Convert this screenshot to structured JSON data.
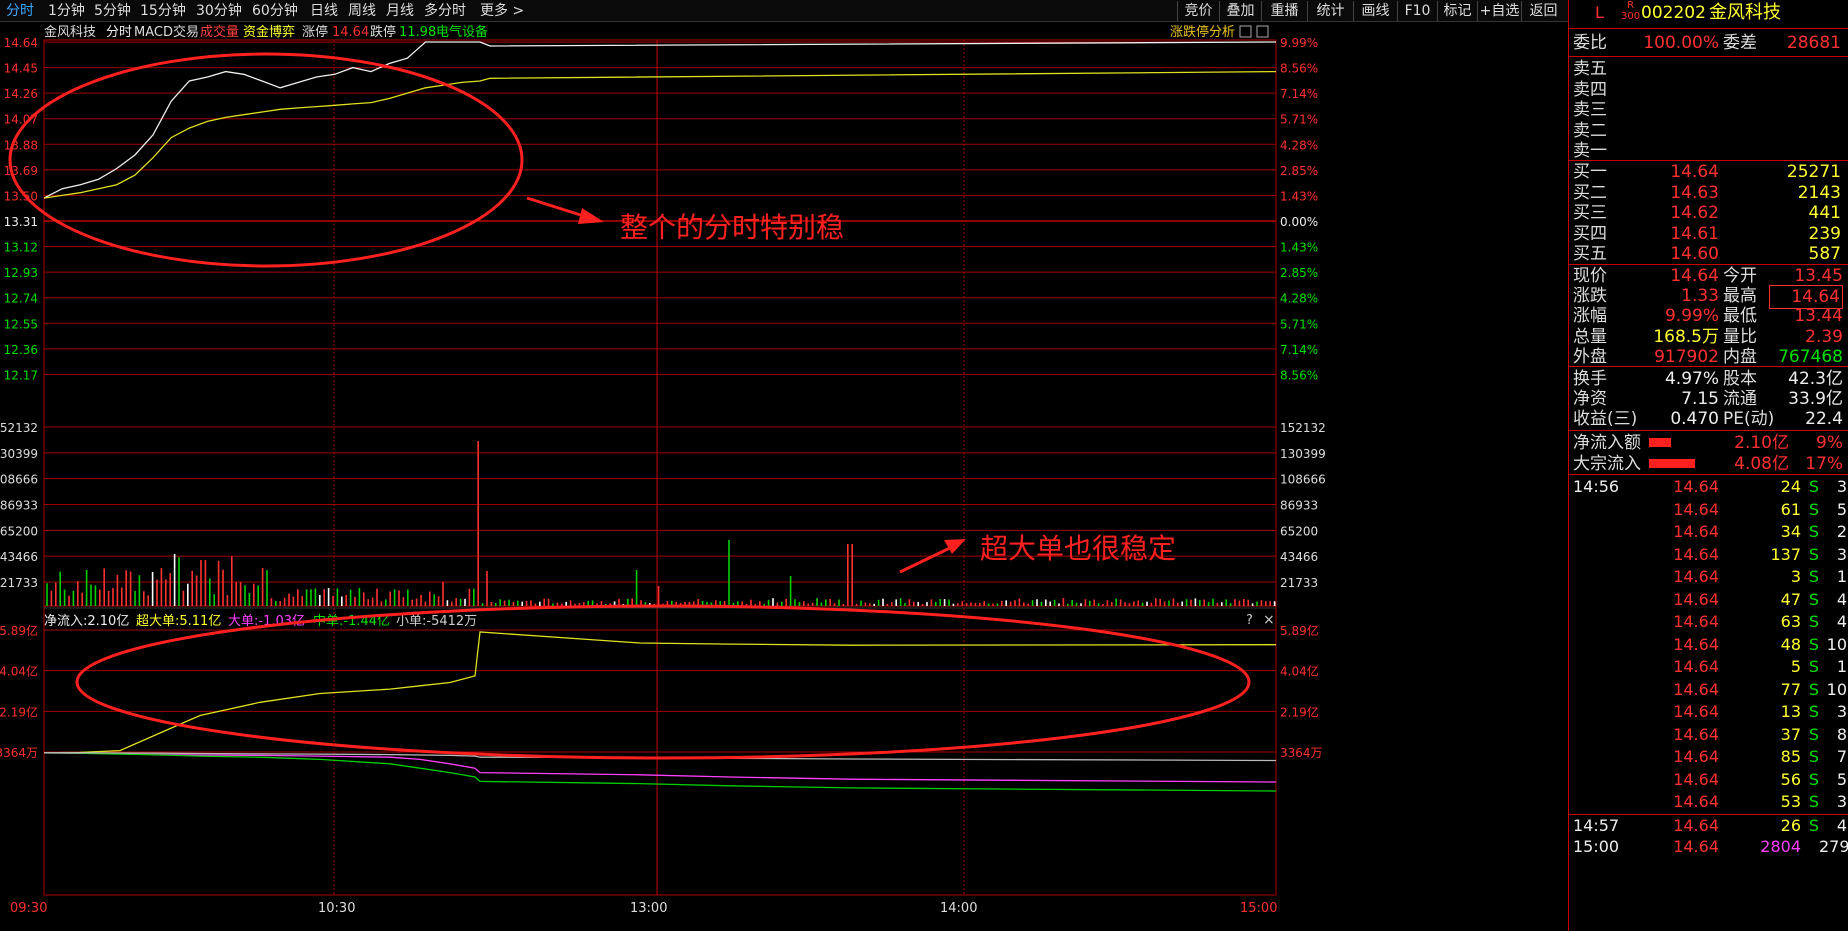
{
  "toolbar": {
    "tabs": [
      "分时",
      "1分钟",
      "5分钟",
      "15分钟",
      "30分钟",
      "60分钟",
      "日线",
      "周线",
      "月线",
      "多分时",
      "更多 >"
    ],
    "right_buttons": [
      "竞价",
      "叠加",
      "重播",
      "统计",
      "画线",
      "F10",
      "标记",
      "+自选",
      "返回"
    ]
  },
  "chart_header": {
    "stock_name": "金风科技",
    "mode": "分时",
    "indicators": [
      "MACD交易",
      "成交量",
      "资金博弈"
    ],
    "limit_up_label": "涨停",
    "limit_up_value": "14.64",
    "limit_down_label": "跌停",
    "limit_down_value": "11.98",
    "sector": "电气设备",
    "analysis_btn": "涨跌停分析"
  },
  "price_axis": {
    "left": [
      "14.64",
      "14.45",
      "14.26",
      "14.07",
      "13.88",
      "13.69",
      "13.50",
      "13.31",
      "13.12",
      "12.93",
      "12.74",
      "12.55",
      "12.36",
      "12.17"
    ],
    "right": [
      "9.99%",
      "8.56%",
      "7.14%",
      "5.71%",
      "4.28%",
      "2.85%",
      "1.43%",
      "0.00%",
      "1.43%",
      "2.85%",
      "4.28%",
      "5.71%",
      "7.14%",
      "8.56%"
    ]
  },
  "volume_axis": {
    "left": [
      "52132",
      "30399",
      "08666",
      "86933",
      "65200",
      "43466",
      "21733"
    ],
    "right": [
      "152132",
      "130399",
      "108666",
      "86933",
      "65200",
      "43466",
      "21733"
    ]
  },
  "flow_header": {
    "net": "净流入:2.10亿",
    "super_large": "超大单:5.11亿",
    "large": "大单:-1.03亿",
    "medium": "中单:-1.44亿",
    "small": "小单:-5412万",
    "help": "?",
    "close": "×"
  },
  "flow_axis": {
    "left": [
      "5.89亿",
      "4.04亿",
      "2.19亿",
      "3364万"
    ],
    "right": [
      "5.89亿",
      "4.04亿",
      "2.19亿",
      "3364万"
    ]
  },
  "time_axis": [
    "09:30",
    "10:30",
    "13:00",
    "14:00",
    "15:00"
  ],
  "annotations": {
    "price_note": "整个的分时特别稳",
    "volume_note": "超大单也很稳定"
  },
  "chart_data": {
    "type": "line",
    "price": {
      "x": [
        "09:30",
        "09:35",
        "09:40",
        "09:45",
        "09:50",
        "09:55",
        "10:00",
        "10:05",
        "10:10",
        "10:15",
        "10:20",
        "10:25",
        "10:30",
        "10:35",
        "10:40",
        "10:45",
        "10:50",
        "10:55",
        "11:00",
        "11:05",
        "11:10",
        "11:15",
        "11:20",
        "11:25",
        "11:30",
        "13:00",
        "15:00"
      ],
      "series": [
        {
          "values": [
            13.48,
            13.55,
            13.58,
            13.62,
            13.7,
            13.8,
            13.95,
            14.2,
            14.35,
            14.38,
            14.42,
            14.4,
            14.35,
            14.3,
            14.34,
            14.38,
            14.4,
            14.45,
            14.42,
            14.48,
            14.52,
            14.64,
            14.64,
            14.64,
            14.64,
            14.61,
            14.64
          ]
        },
        {
          "values": [
            13.48,
            13.5,
            13.52,
            13.55,
            13.58,
            13.65,
            13.78,
            13.93,
            14.0,
            14.05,
            14.08,
            14.1,
            14.12,
            14.14,
            14.15,
            14.16,
            14.17,
            14.18,
            14.19,
            14.22,
            14.26,
            14.3,
            14.32,
            14.34,
            14.35,
            14.37,
            14.42
          ]
        }
      ],
      "ylim": [
        12.17,
        14.64
      ]
    },
    "fund_flow": {
      "series": [
        {
          "name": "超大单",
          "values": [
            0.3,
            0.32,
            0.4,
            1.2,
            2.0,
            2.6,
            3.0,
            3.2,
            3.35,
            3.5,
            3.8,
            5.8,
            5.3,
            5.25,
            5.2,
            5.22
          ]
        },
        {
          "name": "大单",
          "values": [
            0.3,
            0.28,
            0.25,
            0.22,
            0.2,
            0.18,
            0.15,
            0.1,
            0.0,
            -0.2,
            -0.4,
            -0.6,
            -0.7,
            -0.8,
            -0.9,
            -1.03
          ]
        },
        {
          "name": "中单",
          "values": [
            0.3,
            0.28,
            0.24,
            0.2,
            0.15,
            0.1,
            0.0,
            -0.2,
            -0.4,
            -0.6,
            -0.8,
            -1.0,
            -1.1,
            -1.2,
            -1.3,
            -1.44
          ]
        },
        {
          "name": "小单",
          "values": [
            0.3,
            0.3,
            0.29,
            0.28,
            0.27,
            0.25,
            0.24,
            0.22,
            0.2,
            0.18,
            0.15,
            0.1,
            0.08,
            0.05,
            0.02,
            -0.05
          ]
        }
      ],
      "ylim": [
        -1.6,
        6.2
      ]
    }
  },
  "quote_panel": {
    "market_tag": "L",
    "index_tag": "R\n300",
    "code": "002202",
    "name": "金风科技",
    "weibi_label": "委比",
    "weibi_value": "100.00%",
    "weicha_label": "委差",
    "weicha_value": "28681",
    "asks": [
      "卖五",
      "卖四",
      "卖三",
      "卖二",
      "卖一"
    ],
    "bids": [
      {
        "label": "买一",
        "price": "14.64",
        "vol": "25271"
      },
      {
        "label": "买二",
        "price": "14.63",
        "vol": "2143"
      },
      {
        "label": "买三",
        "price": "14.62",
        "vol": "441"
      },
      {
        "label": "买四",
        "price": "14.61",
        "vol": "239"
      },
      {
        "label": "买五",
        "price": "14.60",
        "vol": "587"
      }
    ],
    "stats": [
      {
        "l1": "现价",
        "v1": "14.64",
        "c1": "red",
        "l2": "今开",
        "v2": "13.45",
        "c2": "red"
      },
      {
        "l1": "涨跌",
        "v1": "1.33",
        "c1": "red",
        "l2": "最高",
        "v2": "14.64",
        "c2": "red"
      },
      {
        "l1": "涨幅",
        "v1": "9.99%",
        "c1": "red",
        "l2": "最低",
        "v2": "13.44",
        "c2": "red"
      },
      {
        "l1": "总量",
        "v1": "168.5万",
        "c1": "yellow",
        "l2": "量比",
        "v2": "2.39",
        "c2": "red"
      },
      {
        "l1": "外盘",
        "v1": "917902",
        "c1": "red",
        "l2": "内盘",
        "v2": "767468",
        "c2": "green"
      }
    ],
    "fundamentals": [
      {
        "l1": "换手",
        "v1": "4.97%",
        "l2": "股本",
        "v2": "42.3亿"
      },
      {
        "l1": "净资",
        "v1": "7.15",
        "l2": "流通",
        "v2": "33.9亿"
      },
      {
        "l1": "收益(三)",
        "v1": "0.470",
        "l2": "PE(动)",
        "v2": "22.4"
      }
    ],
    "flows": [
      {
        "label": "净流入额",
        "value": "2.10亿",
        "pct": "9%"
      },
      {
        "label": "大宗流入",
        "value": "4.08亿",
        "pct": "17%"
      }
    ],
    "ticks": [
      {
        "time": "14:56",
        "price": "14.64",
        "vol": "24",
        "bs": "S",
        "n": "3"
      },
      {
        "time": "",
        "price": "14.64",
        "vol": "61",
        "bs": "S",
        "n": "5"
      },
      {
        "time": "",
        "price": "14.64",
        "vol": "34",
        "bs": "S",
        "n": "2"
      },
      {
        "time": "",
        "price": "14.64",
        "vol": "137",
        "bs": "S",
        "n": "3"
      },
      {
        "time": "",
        "price": "14.64",
        "vol": "3",
        "bs": "S",
        "n": "1"
      },
      {
        "time": "",
        "price": "14.64",
        "vol": "47",
        "bs": "S",
        "n": "4"
      },
      {
        "time": "",
        "price": "14.64",
        "vol": "63",
        "bs": "S",
        "n": "4"
      },
      {
        "time": "",
        "price": "14.64",
        "vol": "48",
        "bs": "S",
        "n": "10"
      },
      {
        "time": "",
        "price": "14.64",
        "vol": "5",
        "bs": "S",
        "n": "1"
      },
      {
        "time": "",
        "price": "14.64",
        "vol": "77",
        "bs": "S",
        "n": "10"
      },
      {
        "time": "",
        "price": "14.64",
        "vol": "13",
        "bs": "S",
        "n": "3"
      },
      {
        "time": "",
        "price": "14.64",
        "vol": "37",
        "bs": "S",
        "n": "8"
      },
      {
        "time": "",
        "price": "14.64",
        "vol": "85",
        "bs": "S",
        "n": "7"
      },
      {
        "time": "",
        "price": "14.64",
        "vol": "56",
        "bs": "S",
        "n": "5"
      },
      {
        "time": "",
        "price": "14.64",
        "vol": "53",
        "bs": "S",
        "n": "3"
      },
      {
        "time": "14:57",
        "price": "14.64",
        "vol": "26",
        "bs": "S",
        "n": "4"
      },
      {
        "time": "15:00",
        "price": "14.64",
        "vol": "2804",
        "bs": "",
        "n": "279"
      }
    ]
  }
}
